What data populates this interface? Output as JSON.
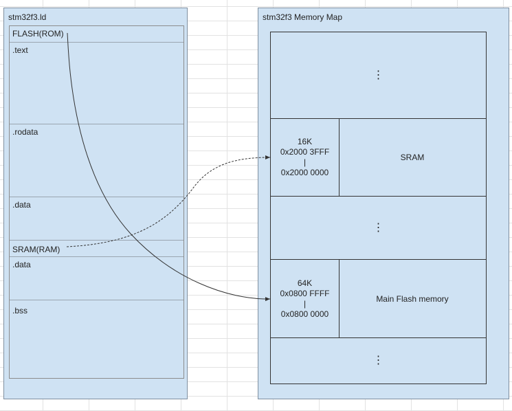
{
  "left_panel": {
    "title": "stm32f3.ld",
    "sections": [
      {
        "label": "FLASH(ROM)"
      },
      {
        "label": ".text"
      },
      {
        "label": ".rodata"
      },
      {
        "label": ".data"
      },
      {
        "label": "SRAM(RAM)"
      },
      {
        "label": ".data"
      },
      {
        "label": ".bss"
      }
    ]
  },
  "right_panel": {
    "title": "stm32f3 Memory Map",
    "regions": [
      {
        "type": "gap",
        "dots": "⋮"
      },
      {
        "type": "region",
        "size": "16K",
        "end_addr": "0x2000 3FFF",
        "separator": "|",
        "start_addr": "0x2000 0000",
        "name": "SRAM"
      },
      {
        "type": "gap",
        "dots": "⋮"
      },
      {
        "type": "region",
        "size": "64K",
        "end_addr": "0x0800 FFFF",
        "separator": "|",
        "start_addr": "0x0800 0000",
        "name": "Main Flash memory"
      },
      {
        "type": "gap",
        "dots": "⋮"
      }
    ]
  },
  "colors": {
    "panel_fill": "#cfe2f3",
    "border": "#333333",
    "connector": "#333333"
  }
}
